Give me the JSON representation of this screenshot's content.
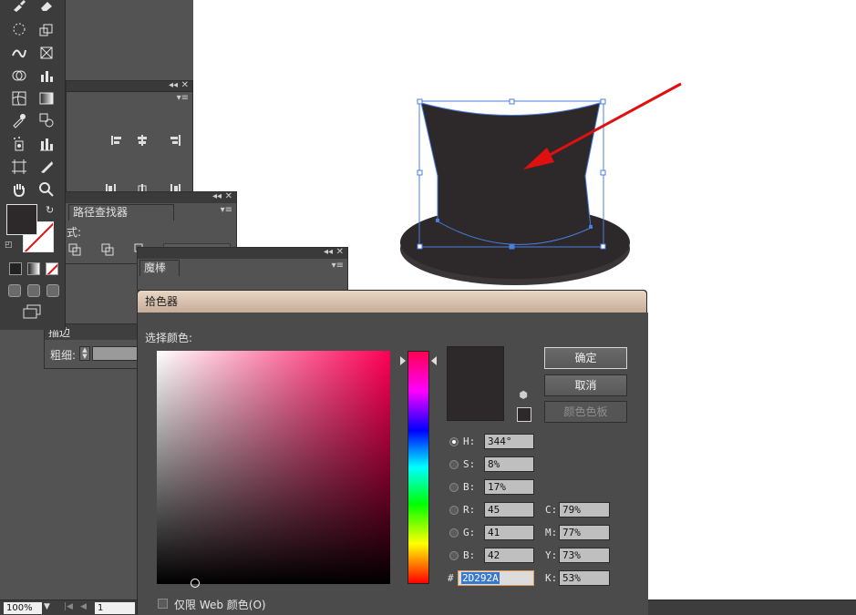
{
  "toolbar": {
    "tools": [
      "paintbrush-icon",
      "eraser-icon",
      "lasso-icon",
      "scale-icon",
      "puppet-warp-icon",
      "free-transform-icon",
      "shape-builder-icon",
      "graph-icon",
      "mesh-icon",
      "gradient-icon",
      "eyedropper-icon",
      "blend-icon",
      "symbol-sprayer-icon",
      "column-graph-icon",
      "artboard-icon",
      "slice-icon",
      "hand-icon",
      "zoom-icon"
    ],
    "fill_color": "#2D292A"
  },
  "panels": {
    "pathfinder": {
      "tab": "路径查找器",
      "label_mode": "式:",
      "label_finder": "找器:"
    },
    "magic_wand": {
      "tab": "魔棒"
    },
    "stroke": {
      "tab": "描边",
      "weight_label": "粗细:"
    }
  },
  "status": {
    "zoom": "100%",
    "page": "1"
  },
  "picker": {
    "title": "拾色器",
    "select_label": "选择颜色:",
    "ok": "确定",
    "cancel": "取消",
    "swatches": "颜色色板",
    "web_only": "仅限 Web 颜色(O)",
    "hsb": [
      {
        "label": "H:",
        "value": "344°",
        "selected": true
      },
      {
        "label": "S:",
        "value": "8%"
      },
      {
        "label": "B:",
        "value": "17%"
      }
    ],
    "rgb": [
      {
        "label": "R:",
        "value": "45"
      },
      {
        "label": "G:",
        "value": "41"
      },
      {
        "label": "B:",
        "value": "42"
      }
    ],
    "cmyk": [
      {
        "label": "C:",
        "value": "79%"
      },
      {
        "label": "M:",
        "value": "77%"
      },
      {
        "label": "Y:",
        "value": "73%"
      },
      {
        "label": "K:",
        "value": "53%"
      }
    ],
    "hex_label": "#",
    "hex": "2D292A",
    "current_color": "#2D292A",
    "arrow_color": "#E01010"
  }
}
